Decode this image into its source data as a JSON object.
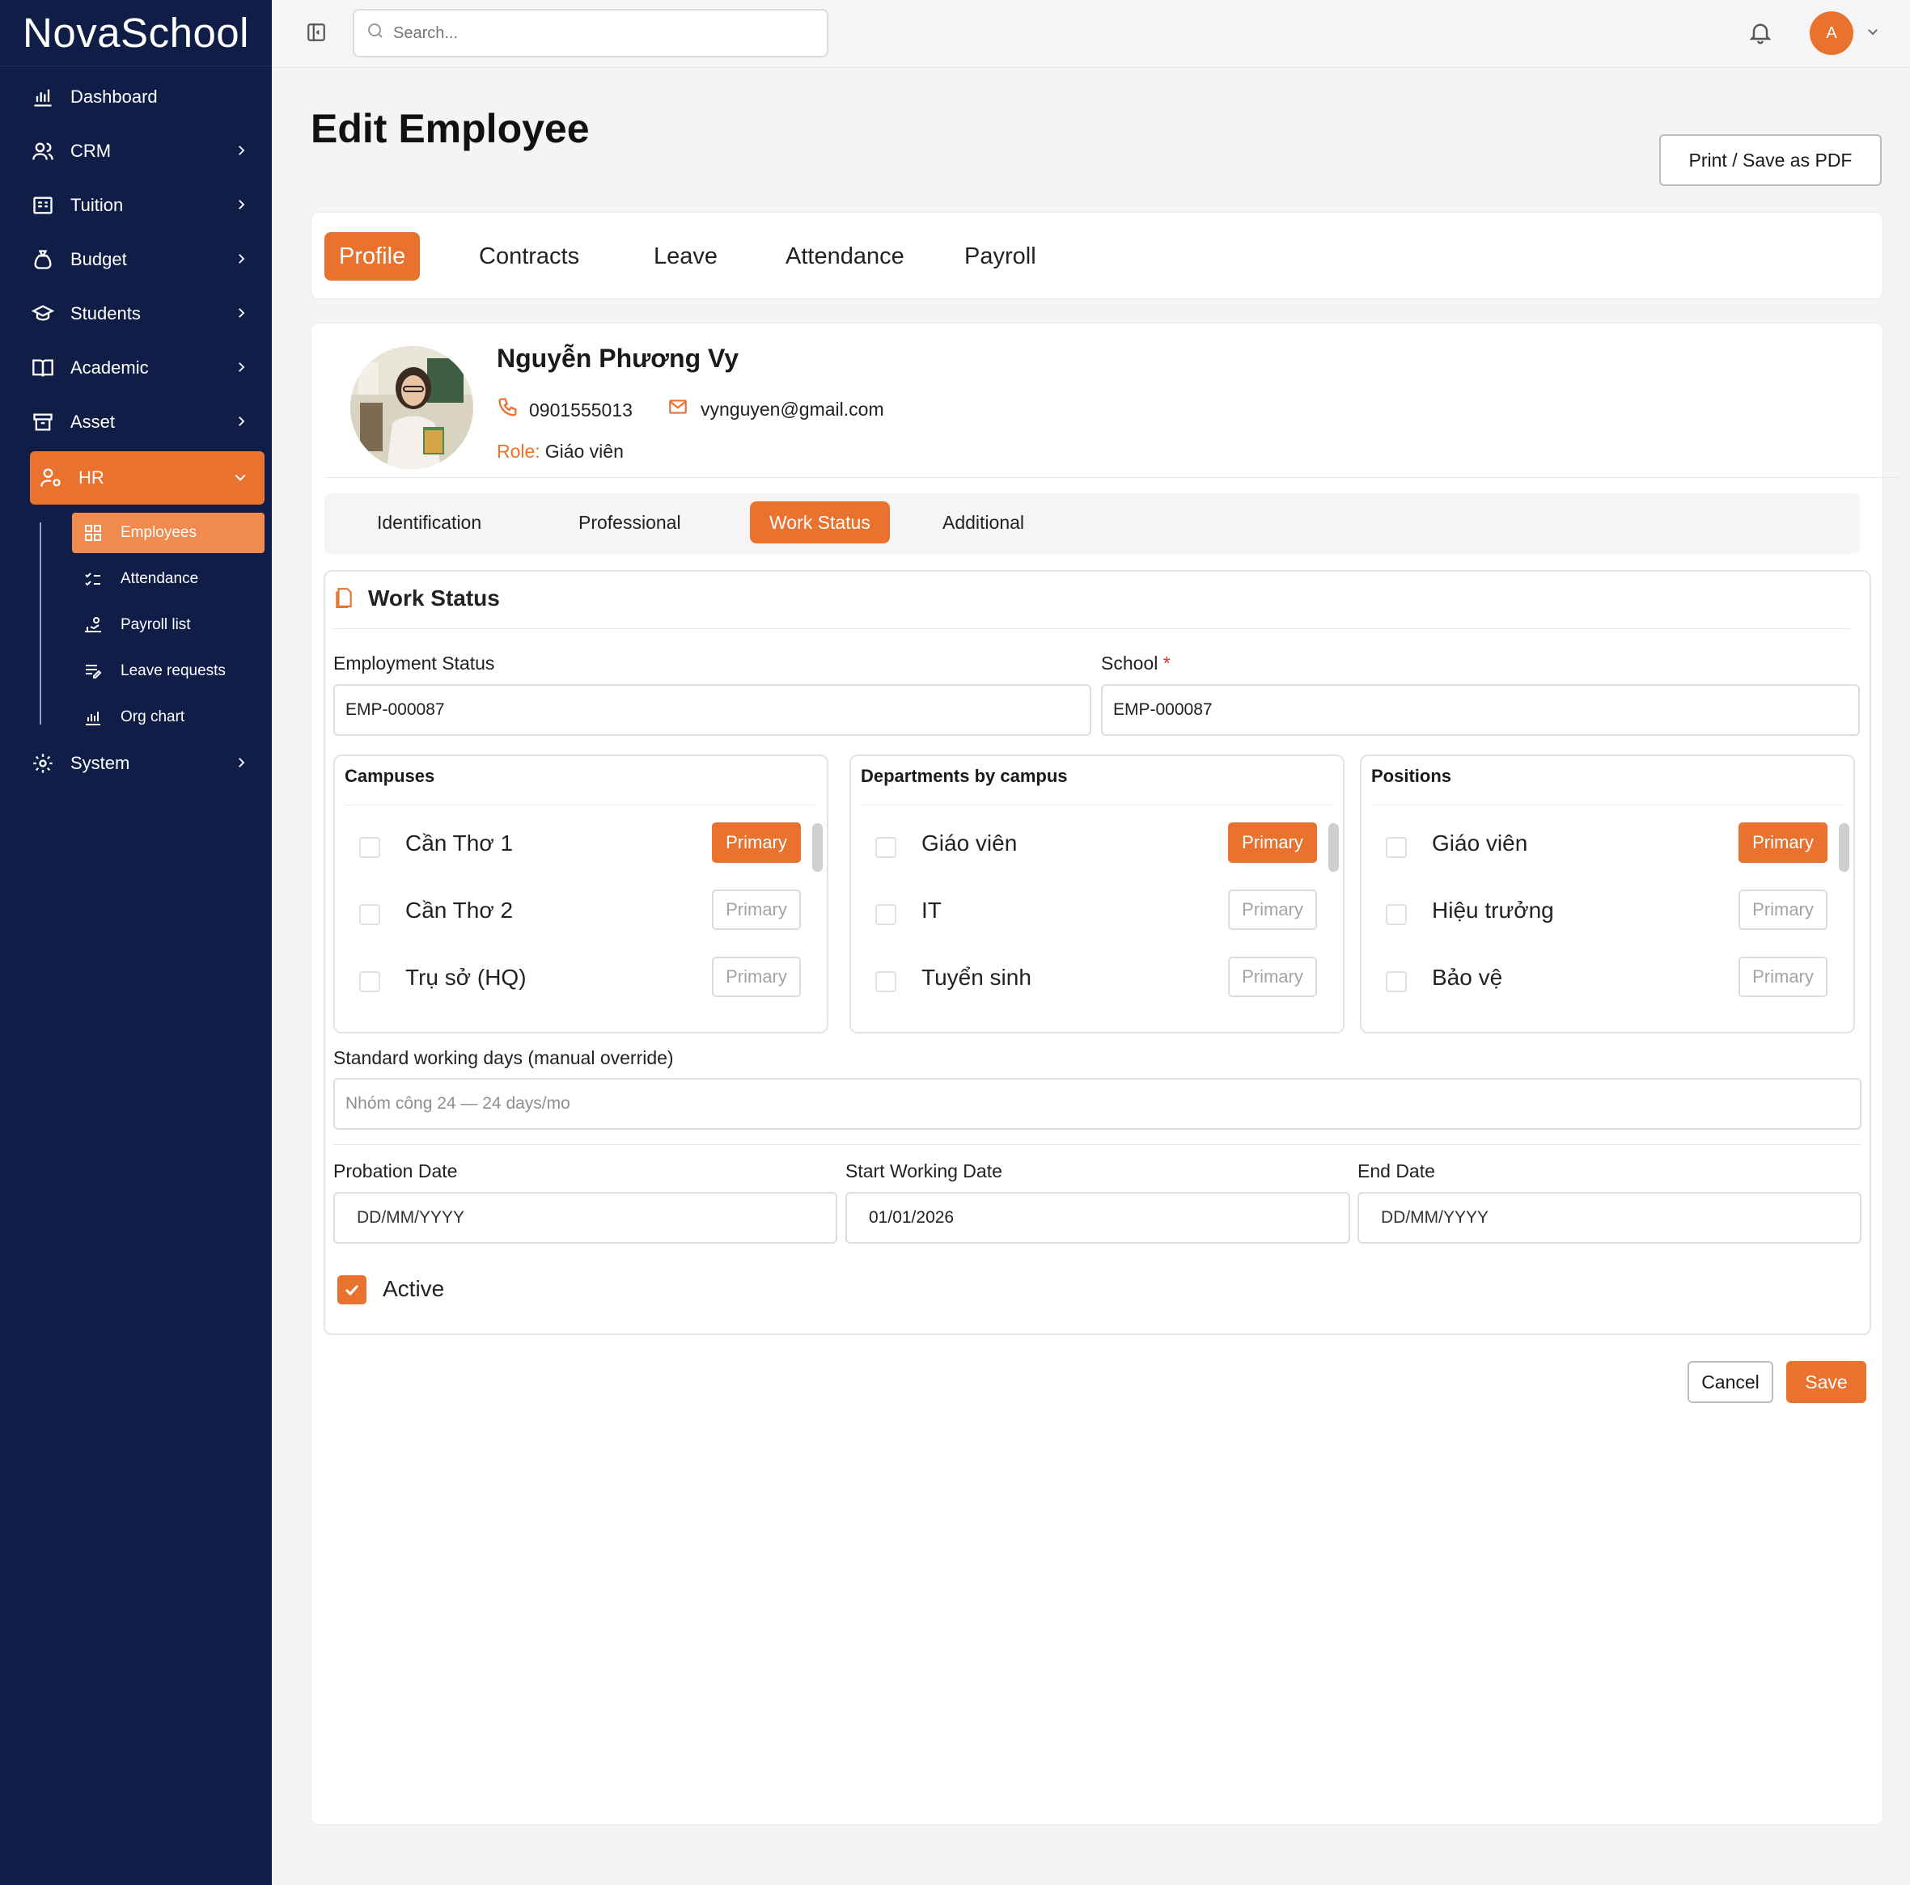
{
  "app": {
    "name": "NovaSchool"
  },
  "sidebar": {
    "items": [
      {
        "label": "Dashboard",
        "icon": "bar-chart-icon"
      },
      {
        "label": "CRM",
        "icon": "users-icon"
      },
      {
        "label": "Tuition",
        "icon": "tuition-icon"
      },
      {
        "label": "Budget",
        "icon": "money-bag-icon"
      },
      {
        "label": "Students",
        "icon": "graduation-cap-icon"
      },
      {
        "label": "Academic",
        "icon": "book-open-icon"
      },
      {
        "label": "Asset",
        "icon": "archive-icon"
      },
      {
        "label": "HR",
        "icon": "hr-icon"
      },
      {
        "label": "System",
        "icon": "gear-icon"
      }
    ],
    "hr_sub": [
      {
        "label": "Employees",
        "icon": "grid-icon"
      },
      {
        "label": "Attendance",
        "icon": "checklist-icon"
      },
      {
        "label": "Payroll list",
        "icon": "payroll-icon"
      },
      {
        "label": "Leave requests",
        "icon": "leave-icon"
      },
      {
        "label": "Org chart",
        "icon": "org-chart-icon"
      }
    ]
  },
  "topbar": {
    "search_placeholder": "Search...",
    "avatar_initial": "A"
  },
  "page": {
    "title": "Edit Employee",
    "print_label": "Print / Save as PDF"
  },
  "tabs": [
    "Profile",
    "Contracts",
    "Leave",
    "Attendance",
    "Payroll"
  ],
  "profile": {
    "name": "Nguyễn Phương Vy",
    "phone": "0901555013",
    "email": "vynguyen@gmail.com",
    "role_label": "Role:",
    "role_value": "Giáo viên"
  },
  "subtabs": [
    "Identification",
    "Professional",
    "Work Status",
    "Additional"
  ],
  "work_status": {
    "title": "Work Status",
    "employment_status_label": "Employment Status",
    "employment_status_value": "EMP-000087",
    "school_label": "School",
    "school_required": "*",
    "school_value": "EMP-000087",
    "primary_label": "Primary",
    "campuses": {
      "title": "Campuses",
      "items": [
        "Cần Thơ 1",
        "Cần Thơ 2",
        "Trụ sở (HQ)"
      ]
    },
    "departments": {
      "title": "Departments by campus",
      "items": [
        "Giáo viên",
        "IT",
        "Tuyển sinh"
      ]
    },
    "positions": {
      "title": "Positions",
      "items": [
        "Giáo viên",
        "Hiệu trưởng",
        "Bảo vệ"
      ]
    },
    "working_days_label": "Standard working days (manual override)",
    "working_days_placeholder": "Nhóm công 24 — 24 days/mo",
    "probation_label": "Probation Date",
    "probation_placeholder": "DD/MM/YYYY",
    "start_label": "Start Working Date",
    "start_value": "01/01/2026",
    "end_label": "End Date",
    "end_placeholder": "DD/MM/YYYY",
    "active_label": "Active"
  },
  "actions": {
    "cancel": "Cancel",
    "save": "Save"
  },
  "colors": {
    "accent": "#e8722e",
    "sidebar": "#0f1d47"
  }
}
